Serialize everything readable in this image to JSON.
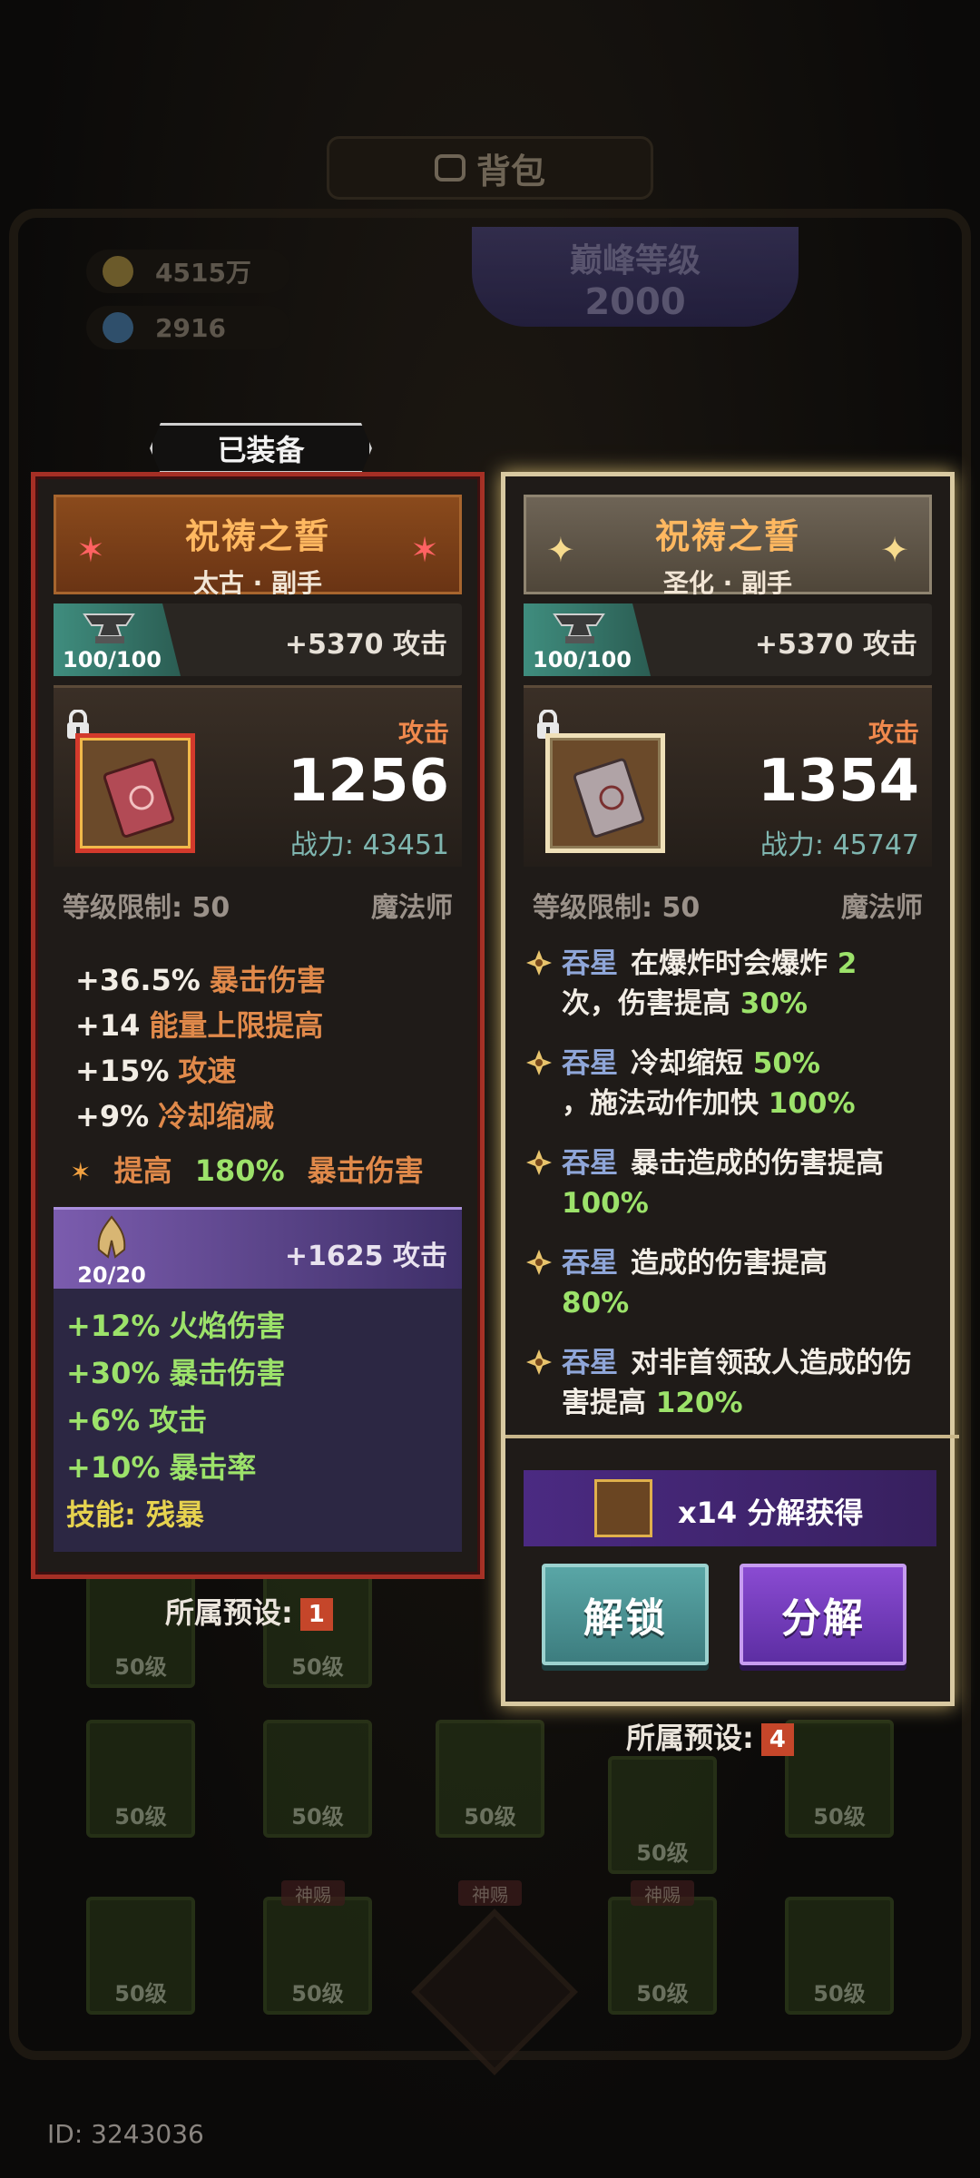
{
  "background": {
    "title": "背包",
    "gold": "4515万",
    "gems": "2916",
    "peak_level_label": "巅峰等级",
    "peak_level_value": "2000",
    "slot_level": "50级",
    "slot_tag": "神赐",
    "player_id": "ID: 3243036"
  },
  "equipped_tag": "已装备",
  "left_card": {
    "name": "祝祷之誓",
    "subtitle": "太古 · 副手",
    "forge_level": "100/100",
    "forge_attack": "+5370 攻击",
    "attack_label": "攻击",
    "attack_value": "1256",
    "power": "战力: 43451",
    "level_req": "等级限制: 50",
    "class": "魔法师",
    "stats": [
      {
        "value": "+36.5%",
        "name": "暴击伤害"
      },
      {
        "value": "+14",
        "name": "能量上限提高"
      },
      {
        "value": "+15%",
        "name": "攻速"
      },
      {
        "value": "+9%",
        "name": "冷却缩减"
      }
    ],
    "bonus": {
      "prefix": "提高",
      "value": "180%",
      "suffix": "暴击伤害"
    },
    "soul": {
      "count": "20/20",
      "attack": "+1625 攻击",
      "stats": [
        {
          "value": "+12%",
          "name": "火焰伤害"
        },
        {
          "value": "+30%",
          "name": "暴击伤害"
        },
        {
          "value": "+6%",
          "name": "攻击"
        },
        {
          "value": "+10%",
          "name": "暴击率"
        }
      ],
      "skill_label": "技能:",
      "skill_name": "残暴"
    },
    "preset_label": "所属预设:",
    "preset_num": "1"
  },
  "right_card": {
    "name": "祝祷之誓",
    "subtitle": "圣化 · 副手",
    "forge_level": "100/100",
    "forge_attack": "+5370 攻击",
    "attack_label": "攻击",
    "attack_value": "1354",
    "power": "战力: 45747",
    "level_req": "等级限制: 50",
    "class": "魔法师",
    "affixes": [
      {
        "tag": "吞星",
        "text_a": "在爆炸时会爆炸",
        "green_a": "2",
        "text_b": "次，伤害提高",
        "green_b": "30%"
      },
      {
        "tag": "吞星",
        "text_a": "冷却缩短",
        "green_a": "50%",
        "text_b": "，施法动作加快",
        "green_b": "100%"
      },
      {
        "tag": "吞星",
        "text_a": "暴击造成的伤害提高",
        "green_a": "",
        "text_b": "",
        "green_b": "100%"
      },
      {
        "tag": "吞星",
        "text_a": "造成的伤害提高",
        "green_a": "",
        "text_b": "",
        "green_b": "80%"
      },
      {
        "tag": "吞星",
        "text_a": "对非首领敌人造成的伤害提高",
        "green_a": "",
        "text_b": "",
        "green_b": "120%"
      }
    ],
    "decompose_text": "x14 分解获得",
    "unlock_button": "解锁",
    "decompose_button": "分解",
    "preset_label": "所属预设:",
    "preset_num": "4"
  },
  "colors": {
    "left_border": "#a52f25",
    "right_border": "#d8c9a1",
    "orange_text": "#e0894a",
    "green_text": "#9ce26a",
    "affix_tag": "#8fa6d8"
  },
  "icons": [
    "bag-icon",
    "coin-icon",
    "gem-icon",
    "anvil-icon",
    "lock-icon",
    "book-icon",
    "soul-hands-icon",
    "diamond-star-icon",
    "scroll-icon"
  ]
}
